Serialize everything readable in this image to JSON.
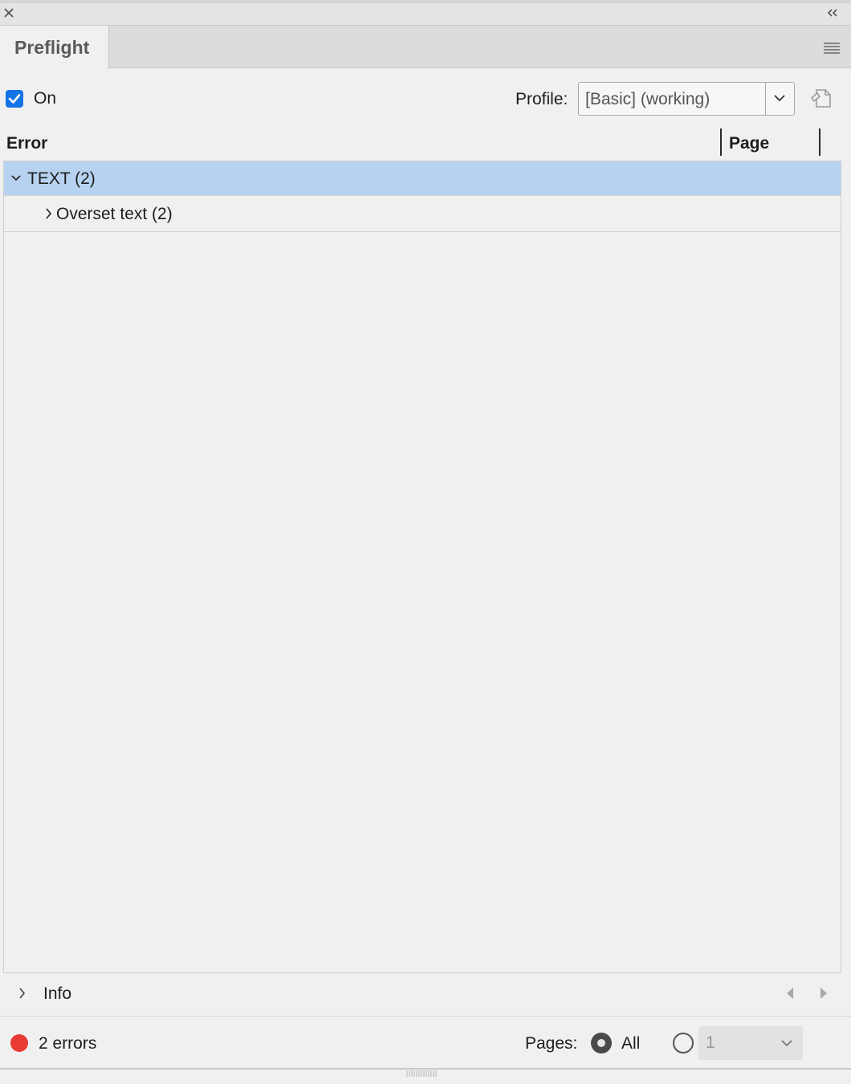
{
  "panel": {
    "tab_title": "Preflight"
  },
  "controls": {
    "on_label": "On",
    "on_checked": true,
    "profile_label": "Profile:",
    "profile_value": "[Basic] (working)"
  },
  "columns": {
    "error": "Error",
    "page": "Page"
  },
  "tree": [
    {
      "label": "TEXT (2)",
      "expanded": true,
      "selected": true
    },
    {
      "label": "Overset text (2)",
      "expanded": false,
      "selected": false
    }
  ],
  "info": {
    "label": "Info"
  },
  "status": {
    "errors_text": "2 errors",
    "indicator_color": "#e93a33",
    "pages_label": "Pages:",
    "all_label": "All",
    "all_selected": true,
    "range_value": "1"
  },
  "colors": {
    "accent": "#1473e6",
    "selected_row": "#b6d2f0"
  },
  "icons": [
    "close-icon",
    "collapse-icon",
    "panel-menu-icon",
    "checkbox-checked-icon",
    "chevron-down-icon",
    "document-icon",
    "chevron-right-icon",
    "prev-arrow-icon",
    "next-arrow-icon",
    "error-dot-icon",
    "radio-icon",
    "grip-icon"
  ]
}
